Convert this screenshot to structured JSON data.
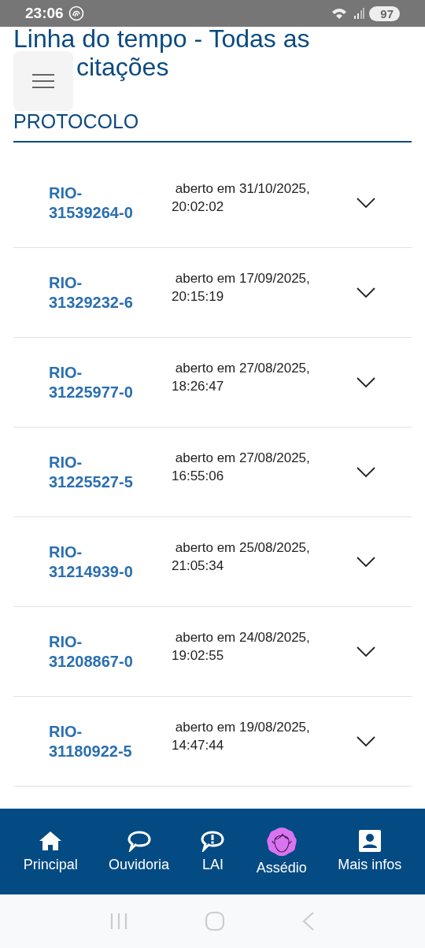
{
  "status_bar": {
    "time": "23:06",
    "battery": "97"
  },
  "title_lines": [
    "Linha do tempo - Todas as",
    "citações"
  ],
  "section_title": "PROTOCOLO",
  "requests": [
    {
      "protocol": "RIO-\n31539264-0",
      "opened": " aberto em 31/10/2025,\n20:02:02",
      "expanded": false
    },
    {
      "protocol": "RIO-\n31329232-6",
      "opened": " aberto em 17/09/2025,\n20:15:19",
      "expanded": false
    },
    {
      "protocol": "RIO-\n31225977-0",
      "opened": " aberto em 27/08/2025,\n18:26:47",
      "expanded": false
    },
    {
      "protocol": "RIO-\n31225527-5",
      "opened": " aberto em 27/08/2025,\n16:55:06",
      "expanded": false
    },
    {
      "protocol": "RIO-\n31214939-0",
      "opened": " aberto em 25/08/2025,\n21:05:34",
      "expanded": false
    },
    {
      "protocol": "RIO-\n31208867-0",
      "opened": " aberto em 24/08/2025,\n19:02:55",
      "expanded": false
    },
    {
      "protocol": "RIO-\n31180922-5",
      "opened": " aberto em 19/08/2025,\n14:47:44",
      "expanded": false
    }
  ],
  "nav": [
    {
      "kind": "home",
      "label": "Principal"
    },
    {
      "kind": "chat",
      "label": "Ouvidoria"
    },
    {
      "kind": "alert",
      "label": "LAI"
    },
    {
      "kind": "woman",
      "label": "Assédio"
    },
    {
      "kind": "person",
      "label": "Mais infos"
    }
  ]
}
